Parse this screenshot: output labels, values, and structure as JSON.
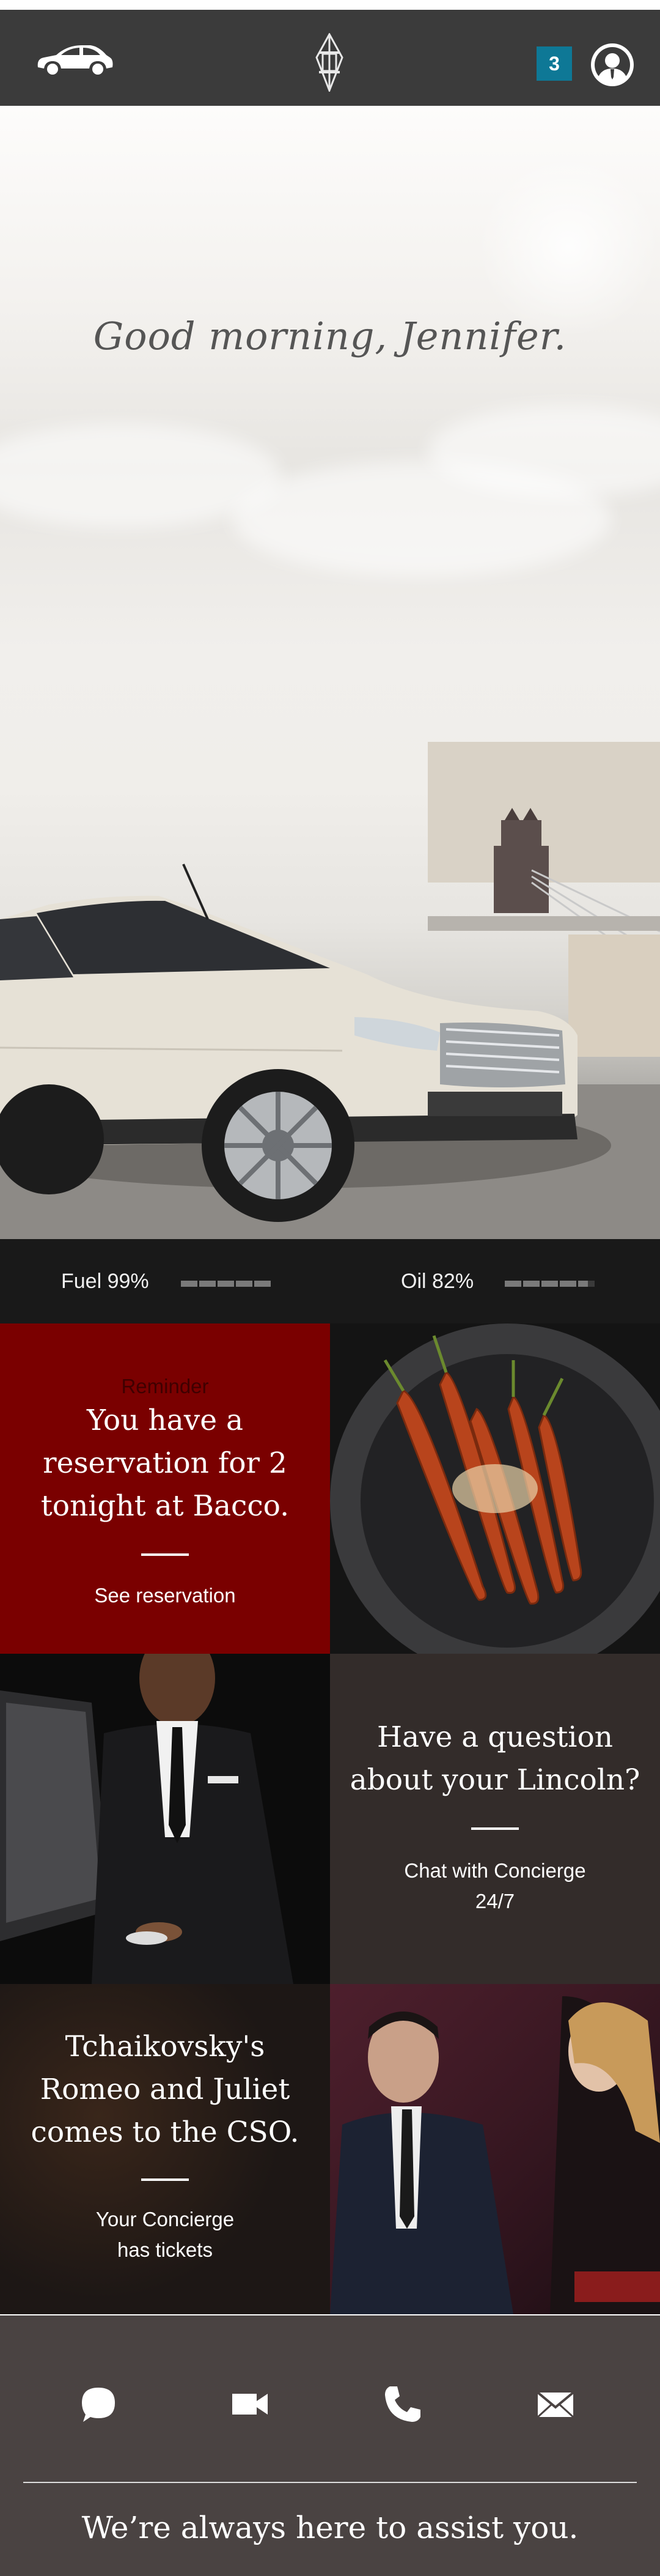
{
  "header": {
    "notification_count": "3",
    "icons": {
      "left": "car-icon",
      "center": "lincoln-logo-icon",
      "right": "profile-icon"
    },
    "accent_color": "#0e7896"
  },
  "hero": {
    "greeting": "Good morning, Jennifer."
  },
  "status": {
    "fuel_label": "Fuel 99%",
    "fuel_level": 0.99,
    "oil_label": "Oil 82%",
    "oil_level": 0.82
  },
  "tiles": {
    "reminder": {
      "eyebrow": "Reminder",
      "line1": "You have a",
      "line2": "reservation for 2",
      "line3": "tonight at Bacco.",
      "link": "See reservation",
      "color": "#7a0000"
    },
    "concierge": {
      "line1": "Have a question",
      "line2": "about your Lincoln?",
      "link_line1": "Chat with Concierge",
      "link_line2": "24/7",
      "color": "#332c2a"
    },
    "event": {
      "line1": "Tchaikovsky's",
      "line2": "Romeo and Juliet",
      "line3": "comes to the CSO.",
      "link_line1": "Your Concierge",
      "link_line2": "has tickets"
    }
  },
  "footer": {
    "icons": [
      "chat-icon",
      "video-icon",
      "phone-icon",
      "mail-icon"
    ],
    "tagline": "We’re always here to assist you."
  }
}
